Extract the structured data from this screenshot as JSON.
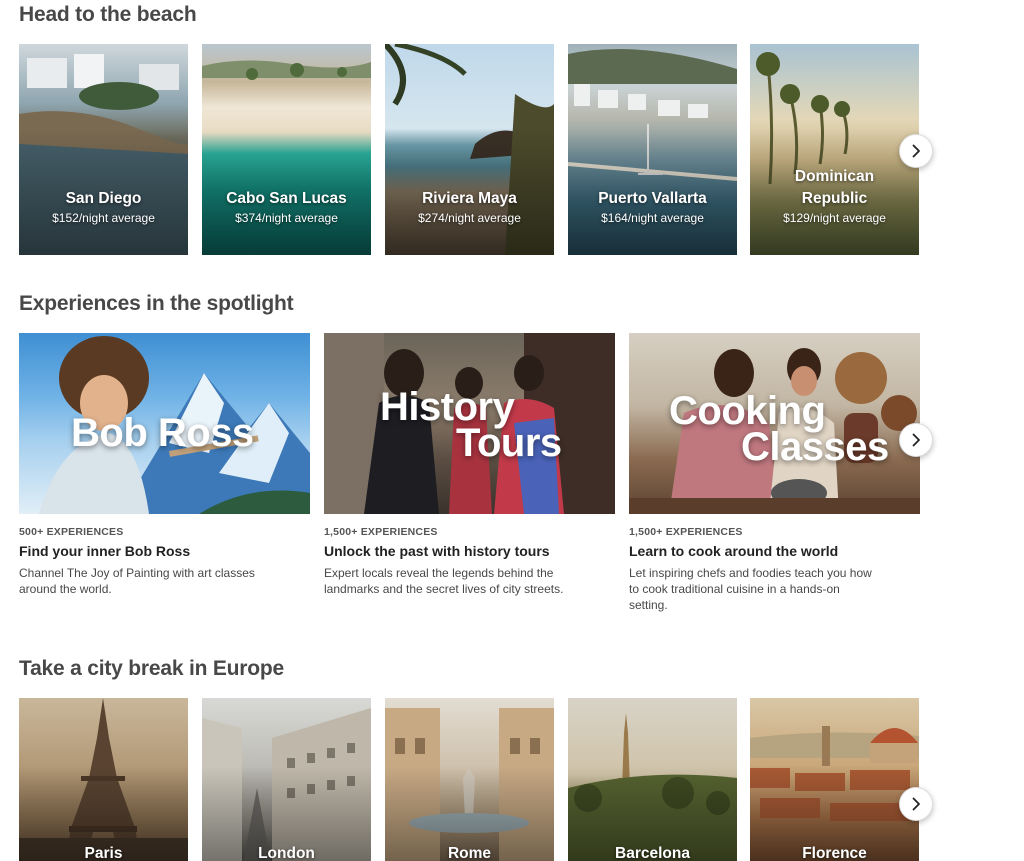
{
  "beach": {
    "title": "Head to the beach",
    "tiles": [
      {
        "city": "San Diego",
        "price": "$152/night average"
      },
      {
        "city": "Cabo San Lucas",
        "price": "$374/night average"
      },
      {
        "city": "Riviera Maya",
        "price": "$274/night average"
      },
      {
        "city": "Puerto Vallarta",
        "price": "$164/night average"
      },
      {
        "city": "Dominican Republic",
        "price": "$129/night average"
      }
    ]
  },
  "experiences": {
    "title": "Experiences in the spotlight",
    "cards": [
      {
        "overlay_line1": "Bob Ross",
        "overlay_line2": "",
        "count": "500+ EXPERIENCES",
        "title": "Find your inner Bob Ross",
        "description": "Channel The Joy of Painting with art classes around the world."
      },
      {
        "overlay_line1": "History",
        "overlay_line2": "Tours",
        "count": "1,500+ EXPERIENCES",
        "title": "Unlock the past with history tours",
        "description": "Expert locals reveal the legends behind the landmarks and the secret lives of city streets."
      },
      {
        "overlay_line1": "Cooking",
        "overlay_line2": "Classes",
        "count": "1,500+ EXPERIENCES",
        "title": "Learn to cook around the world",
        "description": "Let inspiring chefs and foodies teach you how to cook traditional cuisine in a hands-on setting."
      }
    ]
  },
  "europe": {
    "title": "Take a city break in Europe",
    "tiles": [
      {
        "city": "Paris"
      },
      {
        "city": "London"
      },
      {
        "city": "Rome"
      },
      {
        "city": "Barcelona"
      },
      {
        "city": "Florence"
      }
    ]
  },
  "icons": {
    "next": "chevron-right-icon"
  }
}
